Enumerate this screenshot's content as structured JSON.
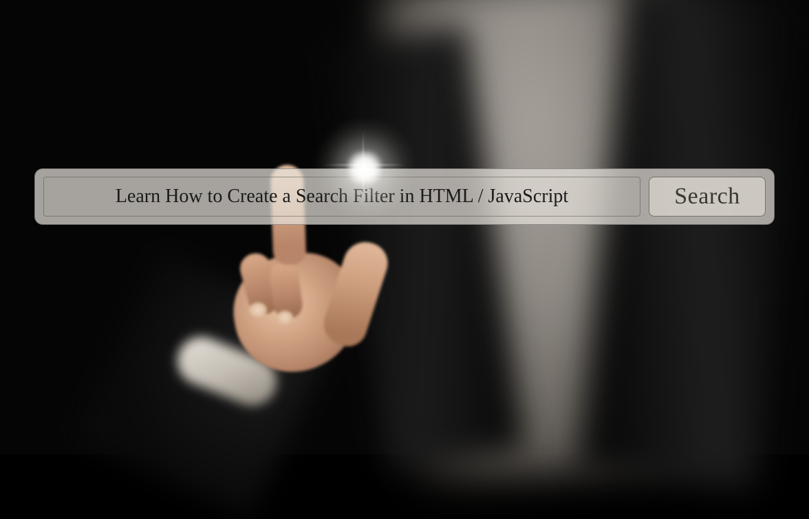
{
  "search": {
    "input_value": "Learn How to Create a Search Filter in HTML / JavaScript",
    "button_label": "Search"
  }
}
